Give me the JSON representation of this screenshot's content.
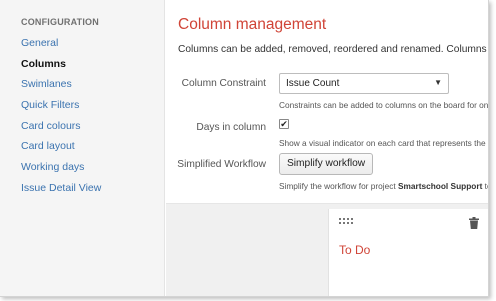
{
  "sidebar": {
    "heading": "CONFIGURATION",
    "items": [
      {
        "label": "General"
      },
      {
        "label": "Columns"
      },
      {
        "label": "Swimlanes"
      },
      {
        "label": "Quick Filters"
      },
      {
        "label": "Card colours"
      },
      {
        "label": "Card layout"
      },
      {
        "label": "Working days"
      },
      {
        "label": "Issue Detail View"
      }
    ],
    "active_item": "Columns"
  },
  "main": {
    "title": "Column management",
    "intro": "Columns can be added, removed, reordered and renamed. Columns are",
    "constraint": {
      "label": "Column Constraint",
      "selected": "Issue Count",
      "help": "Constraints can be added to columns on the board for one"
    },
    "days_in_column": {
      "label": "Days in column",
      "checked": true,
      "check_glyph": "✔",
      "help": "Show a visual indicator on each card that represents the ti"
    },
    "simplified_workflow": {
      "label": "Simplified Workflow",
      "button": "Simplify workflow",
      "help_prefix": "Simplify the workflow for project ",
      "help_project": "Smartschool Support",
      "help_suffix": " to"
    }
  },
  "board": {
    "columns": [
      {
        "name": "To Do"
      }
    ]
  },
  "colors": {
    "accent": "#d04437",
    "link": "#3b73af",
    "sidebar_bg": "#f5f5f5",
    "board_bg": "#f0f0f0"
  },
  "icons": {
    "select_arrow": "▼",
    "drag": "grip-icon",
    "delete": "trash-icon"
  }
}
